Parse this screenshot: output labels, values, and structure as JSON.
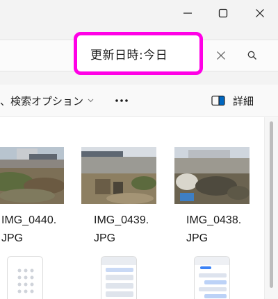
{
  "window": {
    "minimize_label": "",
    "maximize_label": "",
    "close_label": ""
  },
  "search": {
    "query": "更新日時:今日"
  },
  "toolbar": {
    "search_options_label": "、検索オプション",
    "more_label": "•••",
    "details_label": "詳細"
  },
  "files": [
    {
      "name_line1": "IMG_0440.",
      "name_line2": "JPG"
    },
    {
      "name_line1": "IMG_0439.",
      "name_line2": "JPG"
    },
    {
      "name_line1": "IMG_0438.",
      "name_line2": "JPG"
    }
  ],
  "colors": {
    "highlight": "#ff00e6",
    "accent": "#0067c0"
  },
  "icons": [
    "minimize-icon",
    "maximize-icon",
    "close-icon",
    "clear-icon",
    "search-icon",
    "chevron-down-icon",
    "more-icon",
    "details-pane-icon"
  ]
}
